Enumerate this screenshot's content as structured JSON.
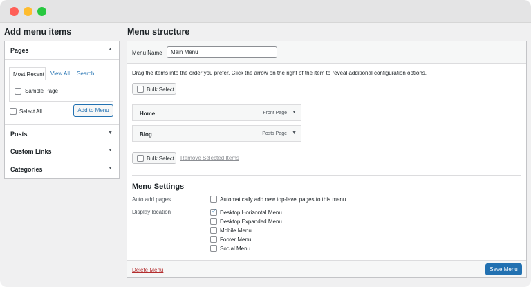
{
  "left": {
    "heading": "Add menu items",
    "sections": [
      {
        "label": "Pages"
      },
      {
        "label": "Posts"
      },
      {
        "label": "Custom Links"
      },
      {
        "label": "Categories"
      }
    ],
    "tabs": [
      "Most Recent",
      "View All",
      "Search"
    ],
    "page_items": [
      "Sample Page"
    ],
    "select_all": "Select All",
    "add_button": "Add to Menu"
  },
  "right": {
    "heading": "Menu structure",
    "menu_name_label": "Menu Name",
    "menu_name_value": "Main Menu",
    "instructions": "Drag the items into the order you prefer. Click the arrow on the right of the item to reveal additional configuration options.",
    "bulk_select": "Bulk Select",
    "items": [
      {
        "title": "Home",
        "type": "Front Page"
      },
      {
        "title": "Blog",
        "type": "Posts Page"
      }
    ],
    "remove_selected": "Remove Selected Items",
    "settings_heading": "Menu Settings",
    "auto_add_label": "Auto add pages",
    "auto_add_text": "Automatically add new top-level pages to this menu",
    "display_location_label": "Display location",
    "locations": [
      {
        "label": "Desktop Horizontal Menu",
        "checked": true
      },
      {
        "label": "Desktop Expanded Menu",
        "checked": false
      },
      {
        "label": "Mobile Menu",
        "checked": false
      },
      {
        "label": "Footer Menu",
        "checked": false
      },
      {
        "label": "Social Menu",
        "checked": false
      }
    ],
    "delete_menu": "Delete Menu",
    "save_menu": "Save Menu"
  }
}
